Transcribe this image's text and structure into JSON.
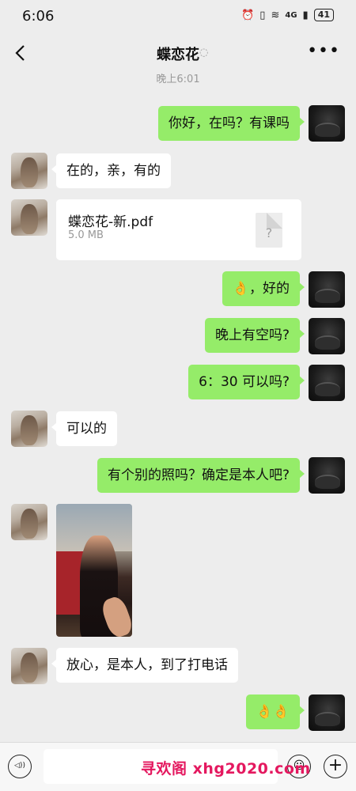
{
  "status_bar": {
    "time": "6:06",
    "battery": "41",
    "signal": "4G"
  },
  "header": {
    "back_icon": "chevron-left-icon",
    "title": "蝶恋花",
    "more_icon": "more-dots-icon"
  },
  "timestamp": "晚上6:01",
  "messages": [
    {
      "from": "me",
      "text": "你好，在吗？有课吗"
    },
    {
      "from": "her",
      "text": "在的，亲，有的"
    },
    {
      "from": "her",
      "type": "file",
      "file_name": "蝶恋花-新.pdf",
      "file_size": "5.0 MB",
      "file_icon": "?"
    },
    {
      "from": "me",
      "text": "👌，好的"
    },
    {
      "from": "me",
      "text": "晚上有空吗?"
    },
    {
      "from": "me",
      "text": "6：30 可以吗?"
    },
    {
      "from": "her",
      "text": "可以的"
    },
    {
      "from": "me",
      "text": "有个别的照吗？确定是本人吧?"
    },
    {
      "from": "her",
      "type": "image"
    },
    {
      "from": "her",
      "text": "放心，是本人，到了打电话"
    },
    {
      "from": "me",
      "text": "👌👌"
    }
  ],
  "bottom_bar": {
    "input_value": "",
    "plus_glyph": "+",
    "voice_glyph": "◁))",
    "emoji_glyph": "☺"
  },
  "watermark": "寻欢阁 xhg2020.com",
  "colors": {
    "my_bubble": "#95ec69",
    "her_bubble": "#ffffff",
    "background": "#ededed",
    "watermark": "#e4185f"
  }
}
